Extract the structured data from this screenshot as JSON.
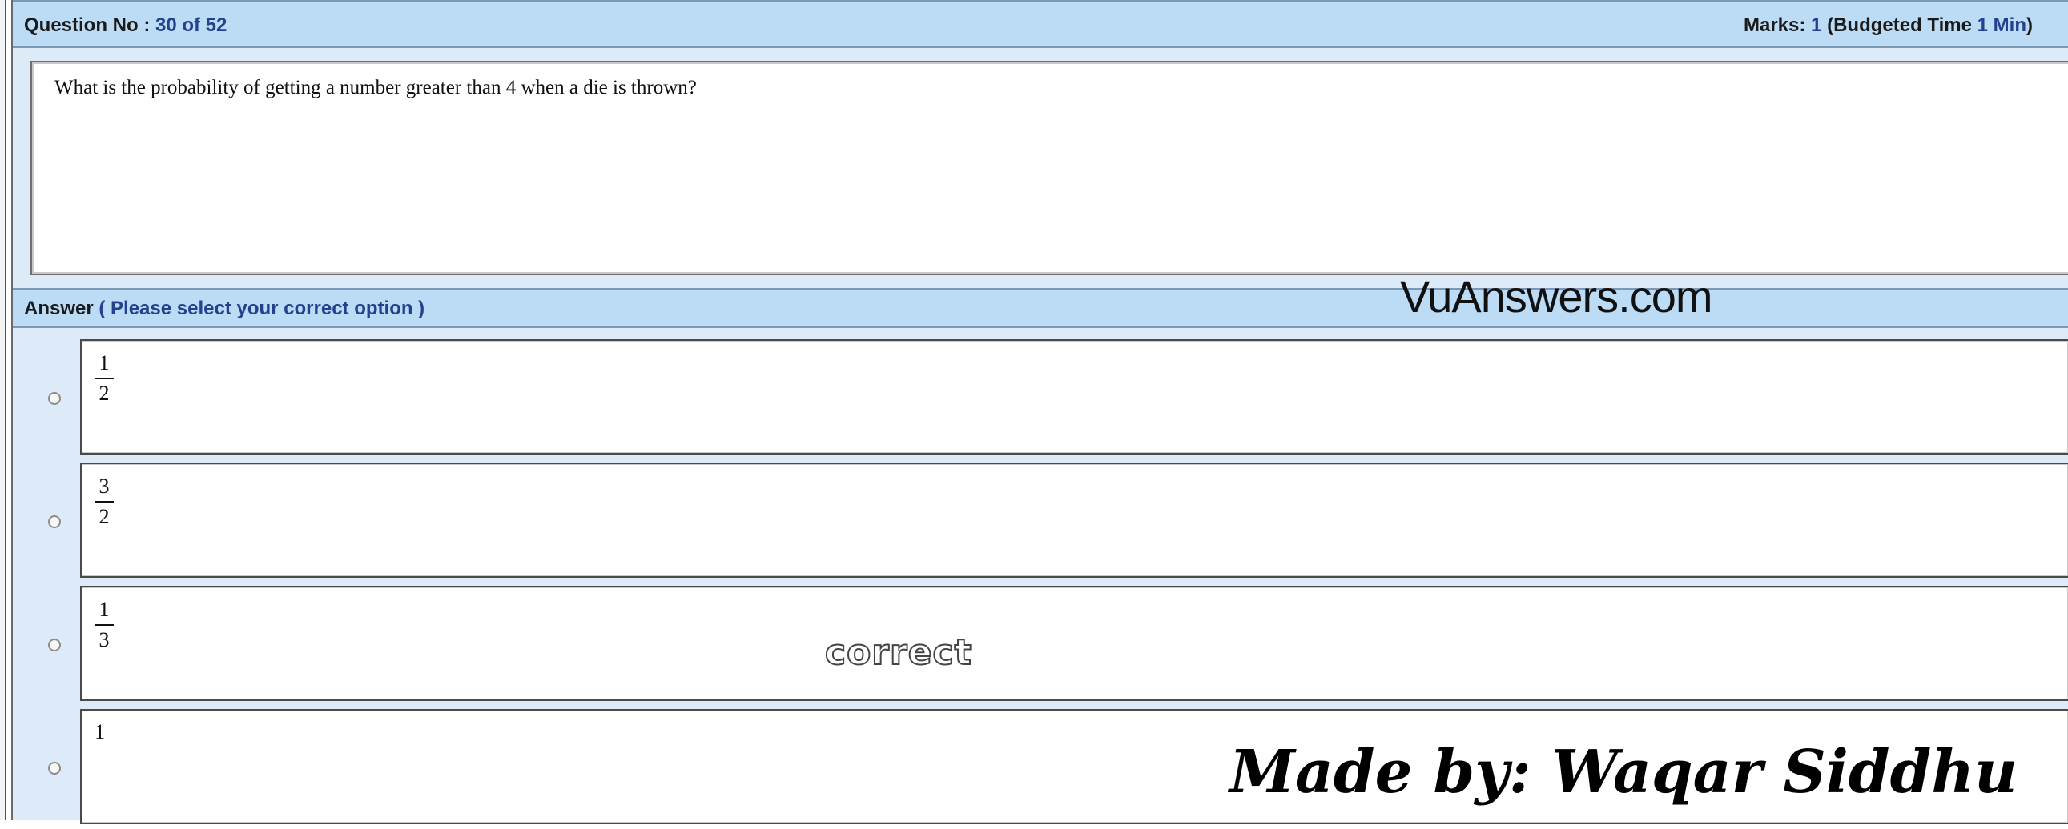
{
  "header": {
    "question_label": "Question No :",
    "question_number": "30 of 52",
    "marks_label": "Marks:",
    "marks_value": "1",
    "budget_label": "(Budgeted Time",
    "budget_value": "1 Min",
    "budget_close": ")"
  },
  "question": {
    "text": "What is the probability of getting a number greater than 4 when a die is thrown?"
  },
  "answer": {
    "label": "Answer",
    "hint": "( Please select your correct option )"
  },
  "options": [
    {
      "numerator": "1",
      "denominator": "2"
    },
    {
      "numerator": "3",
      "denominator": "2"
    },
    {
      "numerator": "1",
      "denominator": "3"
    },
    {
      "text": "1"
    }
  ],
  "annotations": {
    "correct_label": "correct",
    "site_watermark": "VuAnswers.com",
    "credit": "Made by: Waqar Siddhu"
  },
  "colors": {
    "header_bg": "#bcdcf6",
    "accent_text": "#24418f",
    "frame_bg": "#ddebf8"
  }
}
